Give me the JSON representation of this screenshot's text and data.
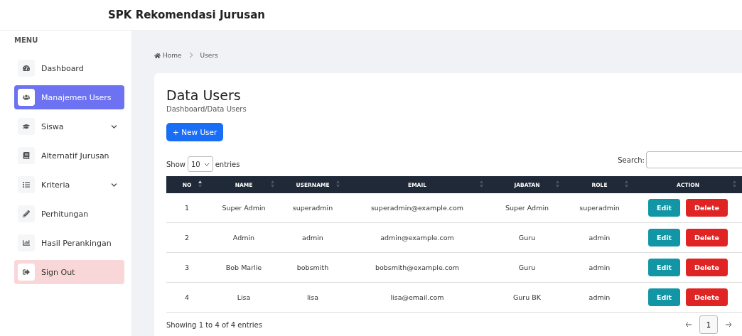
{
  "header": {
    "title": "SPK Rekomendasi Jurusan"
  },
  "sidebar": {
    "heading": "MENU",
    "items": [
      {
        "label": "Dashboard",
        "kind": "link",
        "selected": false,
        "submenu": false
      },
      {
        "label": "Manajemen Users",
        "kind": "link",
        "selected": true,
        "submenu": false
      },
      {
        "label": "Siswa",
        "kind": "link",
        "selected": false,
        "submenu": true
      },
      {
        "label": "Alternatif Jurusan",
        "kind": "link",
        "selected": false,
        "submenu": false
      },
      {
        "label": "Kriteria",
        "kind": "link",
        "selected": false,
        "submenu": true
      },
      {
        "label": "Perhitungan",
        "kind": "link",
        "selected": false,
        "submenu": false
      },
      {
        "label": "Hasil Perankingan",
        "kind": "link",
        "selected": false,
        "submenu": false
      },
      {
        "label": "Sign Out",
        "kind": "logout",
        "selected": false,
        "submenu": false
      }
    ]
  },
  "breadcrumb": [
    "Home",
    "Users"
  ],
  "card": {
    "title": "Data Users",
    "subtitle": "Dashboard/Data Users",
    "new_button": "+ New User",
    "length": {
      "before": "Show",
      "value": "10",
      "after": "entries"
    },
    "search_label": "Search:",
    "table": {
      "columns": [
        {
          "label": "NO",
          "sorted": true
        },
        {
          "label": "NAME",
          "sorted": false
        },
        {
          "label": "USERNAME",
          "sorted": false
        },
        {
          "label": "EMAIL",
          "sorted": false
        },
        {
          "label": "JABATAN",
          "sorted": false
        },
        {
          "label": "ROLE",
          "sorted": false
        },
        {
          "label": "ACTION",
          "sorted": false
        }
      ],
      "rows": [
        {
          "no": "1",
          "name": "Super Admin",
          "username": "superadmin",
          "email": "superadmin@example.com",
          "jabatan": "Super Admin",
          "role": "superadmin",
          "edit": "Edit",
          "delete": "Delete"
        },
        {
          "no": "2",
          "name": "Admin",
          "username": "admin",
          "email": "admin@example.com",
          "jabatan": "Guru",
          "role": "admin",
          "edit": "Edit",
          "delete": "Delete"
        },
        {
          "no": "3",
          "name": "Bob Marlie",
          "username": "bobsmith",
          "email": "bobsmith@example.com",
          "jabatan": "Guru",
          "role": "admin",
          "edit": "Edit",
          "delete": "Delete"
        },
        {
          "no": "4",
          "name": "Lisa",
          "username": "lisa",
          "email": "lisa@email.com",
          "jabatan": "Guru BK",
          "role": "admin",
          "edit": "Edit",
          "delete": "Delete"
        }
      ]
    },
    "info": "Showing 1 to 4 of 4 entries",
    "pagination": {
      "pages": [
        {
          "label": "1",
          "selected": true
        }
      ]
    }
  }
}
